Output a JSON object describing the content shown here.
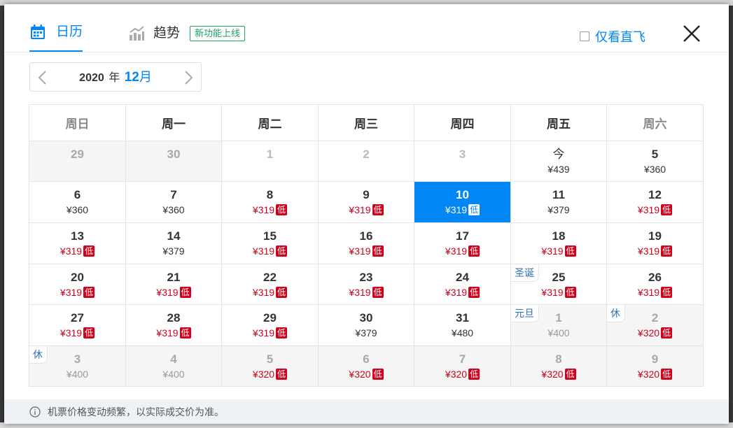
{
  "tabs": {
    "calendar_label": "日历",
    "trend_label": "趋势",
    "new_badge": "新功能上线"
  },
  "direct_only_label": "仅看直飞",
  "month_nav": {
    "year": "2020",
    "year_word": "年",
    "month": "12",
    "month_word": "月"
  },
  "weekdays": [
    "周日",
    "周一",
    "周二",
    "周三",
    "周四",
    "周五",
    "周六"
  ],
  "weeks": [
    [
      {
        "day": "29",
        "price": "",
        "low": "",
        "holiday": ""
      },
      {
        "day": "30",
        "price": "",
        "low": "",
        "holiday": ""
      },
      {
        "day": "1",
        "price": "",
        "low": "",
        "holiday": ""
      },
      {
        "day": "2",
        "price": "",
        "low": "",
        "holiday": ""
      },
      {
        "day": "3",
        "price": "",
        "low": "",
        "holiday": ""
      },
      {
        "day": "今",
        "price": "¥439",
        "low": "",
        "holiday": ""
      },
      {
        "day": "5",
        "price": "¥360",
        "low": "",
        "holiday": ""
      }
    ],
    [
      {
        "day": "6",
        "price": "¥360",
        "low": "",
        "holiday": ""
      },
      {
        "day": "7",
        "price": "¥360",
        "low": "",
        "holiday": ""
      },
      {
        "day": "8",
        "price": "¥319",
        "low": "低",
        "holiday": ""
      },
      {
        "day": "9",
        "price": "¥319",
        "low": "低",
        "holiday": ""
      },
      {
        "day": "10",
        "price": "¥319",
        "low": "低",
        "holiday": ""
      },
      {
        "day": "11",
        "price": "¥379",
        "low": "",
        "holiday": ""
      },
      {
        "day": "12",
        "price": "¥319",
        "low": "低",
        "holiday": ""
      }
    ],
    [
      {
        "day": "13",
        "price": "¥319",
        "low": "低",
        "holiday": ""
      },
      {
        "day": "14",
        "price": "¥379",
        "low": "",
        "holiday": ""
      },
      {
        "day": "15",
        "price": "¥319",
        "low": "低",
        "holiday": ""
      },
      {
        "day": "16",
        "price": "¥319",
        "low": "低",
        "holiday": ""
      },
      {
        "day": "17",
        "price": "¥319",
        "low": "低",
        "holiday": ""
      },
      {
        "day": "18",
        "price": "¥319",
        "low": "低",
        "holiday": ""
      },
      {
        "day": "19",
        "price": "¥319",
        "low": "低",
        "holiday": ""
      }
    ],
    [
      {
        "day": "20",
        "price": "¥319",
        "low": "低",
        "holiday": ""
      },
      {
        "day": "21",
        "price": "¥319",
        "low": "低",
        "holiday": ""
      },
      {
        "day": "22",
        "price": "¥319",
        "low": "低",
        "holiday": ""
      },
      {
        "day": "23",
        "price": "¥319",
        "low": "低",
        "holiday": ""
      },
      {
        "day": "24",
        "price": "¥319",
        "low": "低",
        "holiday": ""
      },
      {
        "day": "25",
        "price": "¥319",
        "low": "低",
        "holiday": "圣诞"
      },
      {
        "day": "26",
        "price": "¥319",
        "low": "低",
        "holiday": ""
      }
    ],
    [
      {
        "day": "27",
        "price": "¥319",
        "low": "低",
        "holiday": ""
      },
      {
        "day": "28",
        "price": "¥319",
        "low": "低",
        "holiday": ""
      },
      {
        "day": "29",
        "price": "¥319",
        "low": "低",
        "holiday": ""
      },
      {
        "day": "30",
        "price": "¥379",
        "low": "",
        "holiday": ""
      },
      {
        "day": "31",
        "price": "¥480",
        "low": "",
        "holiday": ""
      },
      {
        "day": "1",
        "price": "¥400",
        "low": "",
        "holiday": "元旦"
      },
      {
        "day": "2",
        "price": "¥320",
        "low": "低",
        "holiday": "休"
      }
    ],
    [
      {
        "day": "3",
        "price": "¥400",
        "low": "",
        "holiday": "休"
      },
      {
        "day": "4",
        "price": "¥400",
        "low": "",
        "holiday": ""
      },
      {
        "day": "5",
        "price": "¥320",
        "low": "低",
        "holiday": ""
      },
      {
        "day": "6",
        "price": "¥320",
        "low": "低",
        "holiday": ""
      },
      {
        "day": "7",
        "price": "¥320",
        "low": "低",
        "holiday": ""
      },
      {
        "day": "8",
        "price": "¥320",
        "low": "低",
        "holiday": ""
      },
      {
        "day": "9",
        "price": "¥320",
        "low": "低",
        "holiday": ""
      }
    ]
  ],
  "footer_note": "机票价格变动频繁，以实际成交价为准。",
  "colors": {
    "accent": "#0086f6",
    "low_price": "#d0021b",
    "new_badge": "#1aa35a"
  }
}
